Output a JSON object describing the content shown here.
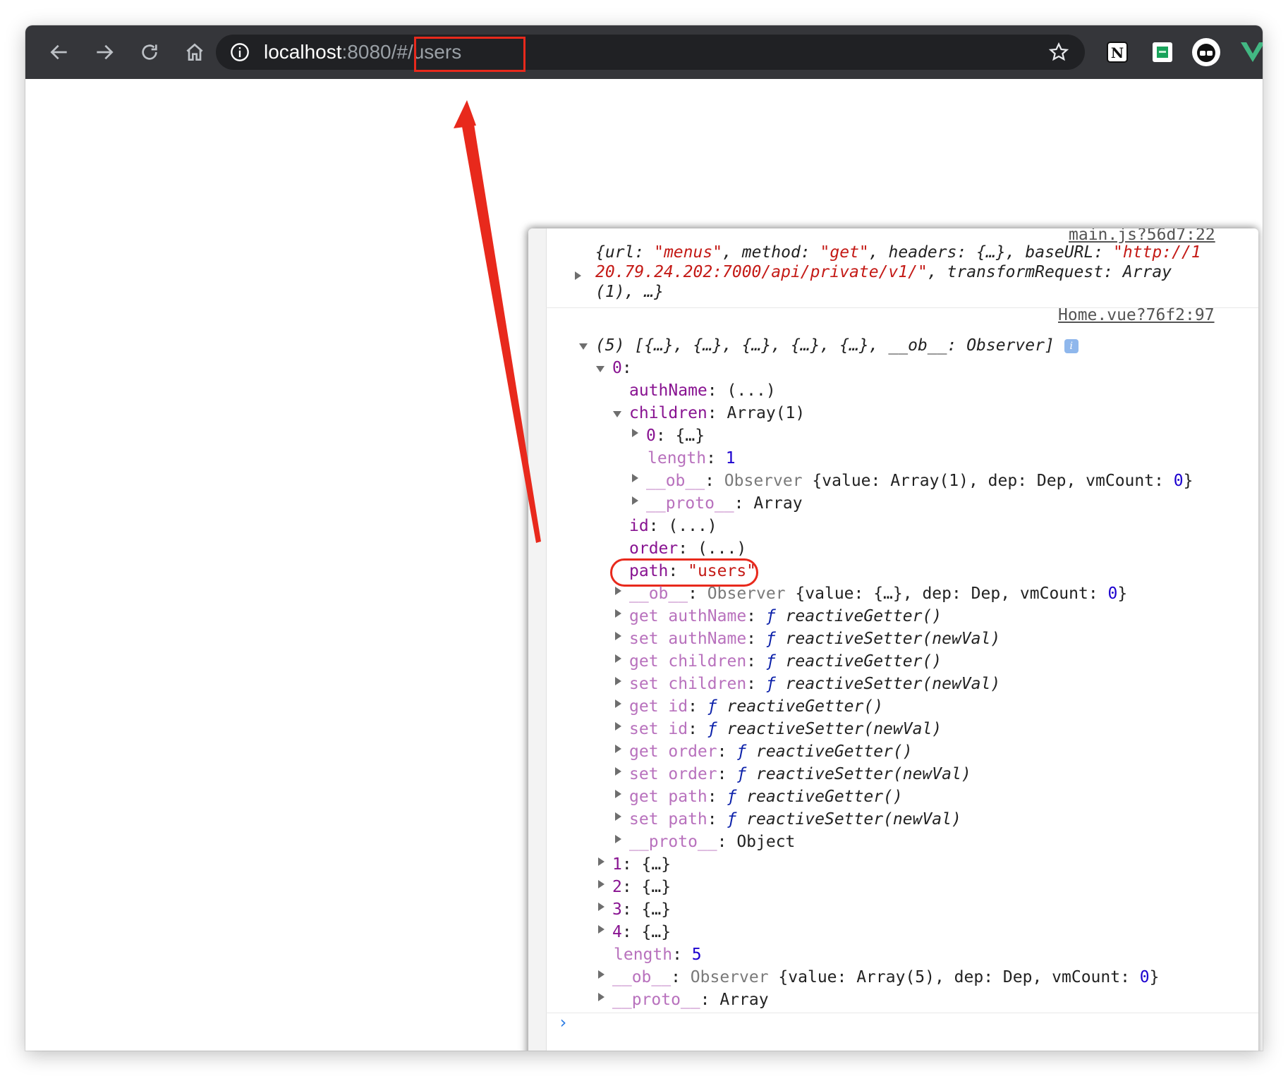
{
  "browser": {
    "url_host": "localhost",
    "url_port": ":8080/",
    "url_hash": "#",
    "url_path": "/users",
    "icons": [
      "back-arrow-icon",
      "forward-arrow-icon",
      "reload-icon",
      "home-icon",
      "info-icon",
      "star-icon",
      "notion-extension-icon",
      "green-extension-icon",
      "profile-extension-icon",
      "vue-devtools-icon"
    ]
  },
  "annotation": {
    "color": "#e8291c"
  },
  "console": {
    "source_1": "main.js?56d7:22",
    "log1": {
      "l1": {
        "p1": "{",
        "k1": "url",
        "p2": ": ",
        "v1": "\"menus\"",
        "p3": ", ",
        "k2": "method",
        "p4": ": ",
        "v2": "\"get\"",
        "p5": ", ",
        "k3": "headers",
        "p6": ": {…}, ",
        "k4": "baseURL",
        "p7": ": ",
        "v3": "\"http://1"
      },
      "l2": {
        "v1": "20.79.24.202:7000/api/private/v1/\"",
        "p1": ", ",
        "k1": "transformRequest",
        "p2": ": Array"
      },
      "l3": "(1), …}"
    },
    "source_2": "Home.vue?76f2:97",
    "array_summary": "(5) [{…}, {…}, {…}, {…}, {…}, __ob__: Observer]",
    "badge": "i",
    "rows": {
      "r0": {
        "key": "0",
        "rest": ":"
      },
      "r1": {
        "key": "authName",
        "rest": ": (...)"
      },
      "r2": {
        "key": "children",
        "rest": ": Array(1)"
      },
      "r3": {
        "key": "0",
        "rest": ": {…}"
      },
      "r4": {
        "key": "length",
        "sep": ": ",
        "num": "1"
      },
      "r5": {
        "key": "__ob__",
        "sep": ": ",
        "gray": "Observer",
        "rest": " {value: Array(1), dep: Dep, vmCount: ",
        "num": "0",
        "end": "}"
      },
      "r6": {
        "key": "__proto__",
        "rest": ": Array"
      },
      "r7": {
        "key": "id",
        "rest": ": (...)"
      },
      "r8": {
        "key": "order",
        "rest": ": (...)"
      },
      "r9": {
        "key": "path",
        "sep": ": ",
        "str": "\"users\""
      },
      "r10": {
        "key": "__ob__",
        "sep": ": ",
        "gray": "Observer",
        "rest": " {value: {…}, dep: Dep, vmCount: ",
        "num": "0",
        "end": "}"
      },
      "r11": {
        "key": "get authName",
        "sep": ": ",
        "f": "ƒ",
        "fn": " reactiveGetter()"
      },
      "r12": {
        "key": "set authName",
        "sep": ": ",
        "f": "ƒ",
        "fn": " reactiveSetter(newVal)"
      },
      "r13": {
        "key": "get children",
        "sep": ": ",
        "f": "ƒ",
        "fn": " reactiveGetter()"
      },
      "r14": {
        "key": "set children",
        "sep": ": ",
        "f": "ƒ",
        "fn": " reactiveSetter(newVal)"
      },
      "r15": {
        "key": "get id",
        "sep": ": ",
        "f": "ƒ",
        "fn": " reactiveGetter()"
      },
      "r16": {
        "key": "set id",
        "sep": ": ",
        "f": "ƒ",
        "fn": " reactiveSetter(newVal)"
      },
      "r17": {
        "key": "get order",
        "sep": ": ",
        "f": "ƒ",
        "fn": " reactiveGetter()"
      },
      "r18": {
        "key": "set order",
        "sep": ": ",
        "f": "ƒ",
        "fn": " reactiveSetter(newVal)"
      },
      "r19": {
        "key": "get path",
        "sep": ": ",
        "f": "ƒ",
        "fn": " reactiveGetter()"
      },
      "r20": {
        "key": "set path",
        "sep": ": ",
        "f": "ƒ",
        "fn": " reactiveSetter(newVal)"
      },
      "r21": {
        "key": "__proto__",
        "rest": ": Object"
      },
      "r22": {
        "key": "1",
        "rest": ": {…}"
      },
      "r23": {
        "key": "2",
        "rest": ": {…}"
      },
      "r24": {
        "key": "3",
        "rest": ": {…}"
      },
      "r25": {
        "key": "4",
        "rest": ": {…}"
      },
      "r26": {
        "key": "length",
        "sep": ": ",
        "num": "5"
      },
      "r27": {
        "key": "__ob__",
        "sep": ": ",
        "gray": "Observer",
        "rest": " {value: Array(5), dep: Dep, vmCount: ",
        "num": "0",
        "end": "}"
      },
      "r28": {
        "key": "__proto__",
        "rest": ": Array"
      }
    },
    "prompt": "›"
  }
}
